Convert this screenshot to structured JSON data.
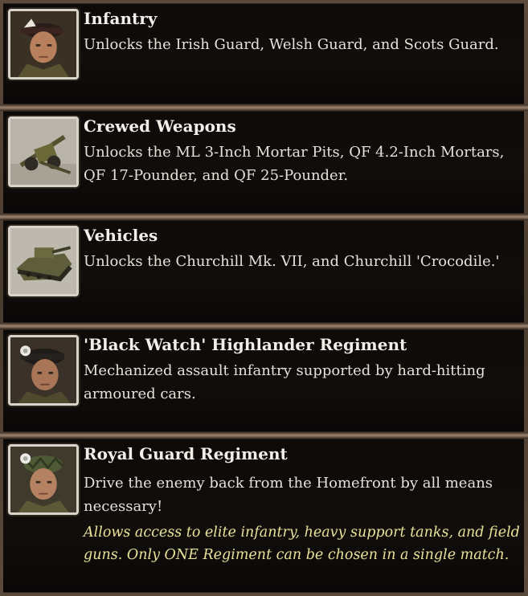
{
  "entries": [
    {
      "title": "Infantry",
      "description": "Unlocks the Irish Guard, Welsh Guard, and Scots Guard.",
      "icon": "infantry-soldier-portrait"
    },
    {
      "title": "Crewed Weapons",
      "description": "Unlocks the ML 3-Inch Mortar Pits, QF 4.2-Inch Mortars, QF 17-Pounder, and QF 25-Pounder.",
      "icon": "field-gun-portrait"
    },
    {
      "title": "Vehicles",
      "description": "Unlocks the Churchill Mk. VII, and Churchill 'Crocodile.'",
      "icon": "churchill-tank-portrait"
    },
    {
      "title": "'Black Watch' Highlander Regiment",
      "description": "Mechanized assault infantry supported by hard-hitting armoured cars.",
      "icon": "highlander-soldier-portrait"
    },
    {
      "title": "Royal Guard Regiment",
      "description": "Drive the enemy back from the Homefront by all means necessary!",
      "note": "Allows access to elite infantry, heavy support tanks, and field guns. Only ONE Regiment can be chosen in a single match.",
      "icon": "royal-guard-soldier-portrait"
    }
  ],
  "colors": {
    "title": "#f2efe8",
    "description": "#e6e2da",
    "note": "#e7e19a",
    "card_bg": "#0d0b09"
  }
}
